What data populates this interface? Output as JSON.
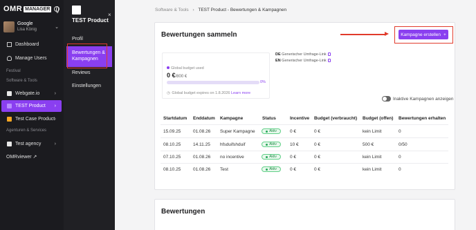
{
  "sidebar": {
    "logo": "OMR",
    "logo_badge": "MANAGER",
    "user": {
      "org": "Google",
      "name": "Lisa König"
    },
    "nav": [
      {
        "label": "Dashboard",
        "icon": "grid-icon"
      },
      {
        "label": "Manage Users",
        "icon": "users-icon"
      }
    ],
    "section_festival": "Festival",
    "section_software": "Software & Tools",
    "software_items": [
      {
        "label": "Webgate.io"
      },
      {
        "label": "TEST Product"
      },
      {
        "label": "Test Case Product"
      }
    ],
    "section_agencies": "Agenturen & Services",
    "agency_items": [
      {
        "label": "Test agency"
      }
    ],
    "omrviewer": "OMRviewer",
    "omrviewer_arrow": "↗"
  },
  "panel2": {
    "title": "TEST Product",
    "items": {
      "profil": "Profil",
      "bewertungen": "Bewertungen & Kampagnen",
      "reviews": "Reviews",
      "einstellungen": "Einstellungen"
    },
    "close": "×"
  },
  "breadcrumb": {
    "parent": "Software & Tools",
    "sep": "›",
    "current": "TEST Product - Bewertungen & Kampagnen"
  },
  "section1": {
    "title": "Bewertungen sammeln",
    "cta": "Kampagne erstellen",
    "cta_plus": "+",
    "budget": {
      "used_label": "Global budget used",
      "amount": "0 €",
      "total": "/800 €",
      "percent": "0%",
      "percent_value": 0,
      "expires": "Global budget expires on 1.8.2026",
      "learn_more": "Learn more"
    },
    "links": [
      {
        "lang": "DE",
        "label": "Generischer Umfrage-Link"
      },
      {
        "lang": "EN",
        "label": "Generischer Umfrage-Link"
      }
    ],
    "toggle_label": "Inaktive Kampagnen anzeigen",
    "table": {
      "headers": [
        "Startdatum",
        "Enddatum",
        "Kampagne",
        "Status",
        "Incentive",
        "Budget (verbraucht)",
        "Budget (offen)",
        "Bewertungen erhalten"
      ],
      "rows": [
        [
          "15.09.25",
          "01.08.26",
          "Super Kampagne",
          "Aktiv",
          "0 €",
          "0 €",
          "kein Limit",
          "0"
        ],
        [
          "08.10.25",
          "14.11.25",
          "hfsduifshduif",
          "Aktiv",
          "10 €",
          "0 €",
          "500 €",
          "0/50"
        ],
        [
          "07.10.25",
          "01.08.26",
          "no incentive",
          "Aktiv",
          "0 €",
          "0 €",
          "kein Limit",
          "0"
        ],
        [
          "08.10.25",
          "01.08.26",
          "Test",
          "Aktiv",
          "0 €",
          "0 €",
          "kein Limit",
          "0"
        ]
      ]
    }
  },
  "section2": {
    "title": "Bewertungen"
  }
}
